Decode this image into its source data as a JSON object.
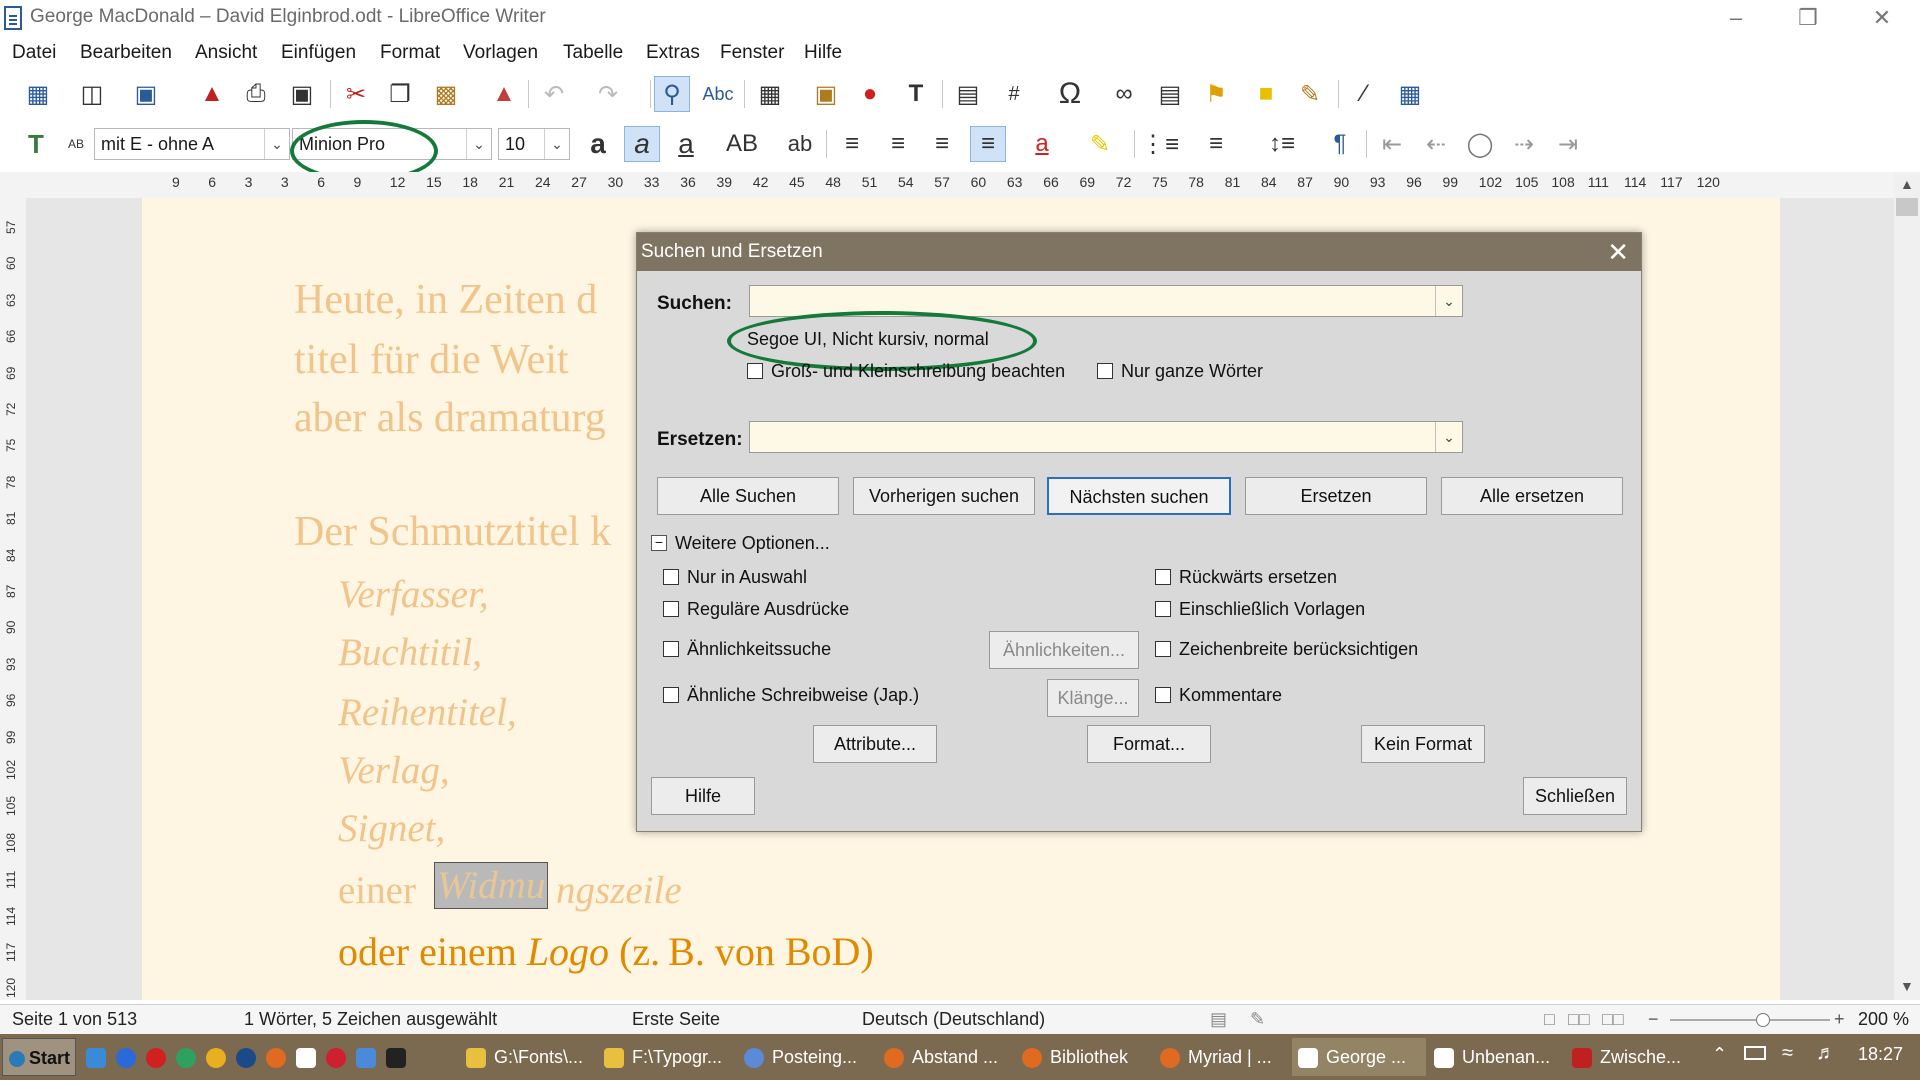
{
  "window": {
    "title": "George MacDonald – David Elginbrod.odt - LibreOffice Writer",
    "controls": [
      "–",
      "❒",
      "✕"
    ]
  },
  "menu": [
    "Datei",
    "Bearbeiten",
    "Ansicht",
    "Einfügen",
    "Format",
    "Vorlagen",
    "Tabelle",
    "Extras",
    "Fenster",
    "Hilfe"
  ],
  "formatting": {
    "paragraph_style": "mit E - ohne A",
    "font_name": "Minion Pro",
    "font_size": "10"
  },
  "ruler_ticks": [
    "9",
    "6",
    "3",
    "3",
    "6",
    "9",
    "12",
    "15",
    "18",
    "21",
    "24",
    "27",
    "30",
    "33",
    "36",
    "39",
    "42",
    "45",
    "48",
    "51",
    "54",
    "57",
    "60",
    "63",
    "66",
    "69",
    "72",
    "75",
    "78",
    "81",
    "84",
    "87",
    "90",
    "93",
    "96",
    "99",
    "102",
    "105",
    "108",
    "111",
    "114",
    "117",
    "120"
  ],
  "vruler_ticks": [
    "57",
    "60",
    "63",
    "66",
    "69",
    "72",
    "75",
    "78",
    "81",
    "84",
    "87",
    "90",
    "93",
    "96",
    "99",
    "102",
    "105",
    "108",
    "111",
    "114",
    "117",
    "120"
  ],
  "document": {
    "line1": "Heute, in Zeiten d",
    "line2": "titel  für  die  Weit",
    "line3": "aber als dramaturg",
    "line4": "Der Schmutztitel k",
    "list": [
      "Verfasser,",
      "Buchtitil,",
      "Reihentitel,",
      "Verlag,",
      "Signet,"
    ],
    "einer": "einer",
    "selected": "Widmu",
    "rest": "ngszeile",
    "last_a": "oder einem ",
    "last_logo": "Logo",
    "last_b": " (z. B. von BoD)"
  },
  "dialog": {
    "title": "Suchen und Ersetzen",
    "search_label": "Suchen:",
    "search_value": "",
    "attributes_text": "Segoe UI, Nicht kursiv, normal",
    "match_case": "Groß- und Kleinschreibung beachten",
    "whole_words": "Nur ganze Wörter",
    "replace_label": "Ersetzen:",
    "replace_value": "",
    "buttons": {
      "find_all": "Alle Suchen",
      "find_prev": "Vorherigen suchen",
      "find_next": "Nächsten suchen",
      "replace": "Ersetzen",
      "replace_all": "Alle ersetzen"
    },
    "more_options": "Weitere Optionen...",
    "options": {
      "selection_only": "Nur in Auswahl",
      "regex": "Reguläre Ausdrücke",
      "similarity": "Ähnlichkeitssuche",
      "similar_jap": "Ähnliche Schreibweise (Jap.)",
      "replace_backwards": "Rückwärts ersetzen",
      "incl_styles": "Einschließlich Vorlagen",
      "char_width": "Zeichenbreite berücksichtigen",
      "comments": "Kommentare"
    },
    "similarities_button": "Ähnlichkeiten...",
    "sounds_button": "Klänge...",
    "attribute_button": "Attribute...",
    "format_button": "Format...",
    "no_format_button": "Kein Format",
    "help_button": "Hilfe",
    "close_button": "Schließen"
  },
  "statusbar": {
    "page": "Seite 1 von 513",
    "words": "1 Wörter, 5 Zeichen ausgewählt",
    "page_style": "Erste Seite",
    "language": "Deutsch (Deutschland)",
    "zoom": "200 %"
  },
  "taskbar": {
    "start": "Start",
    "items": [
      "G:\\Fonts\\...",
      "F:\\Typogr...",
      "Posteing...",
      "Abstand ...",
      "Bibliothek",
      "Myriad | ...",
      "George ...",
      "Unbenan...",
      "Zwische..."
    ],
    "clock": "18:27"
  },
  "colors": {
    "dialog_title": "#7f7361",
    "taskbar": "#7b6a4f",
    "annotation": "#137a3a",
    "page": "#fef6e2"
  }
}
